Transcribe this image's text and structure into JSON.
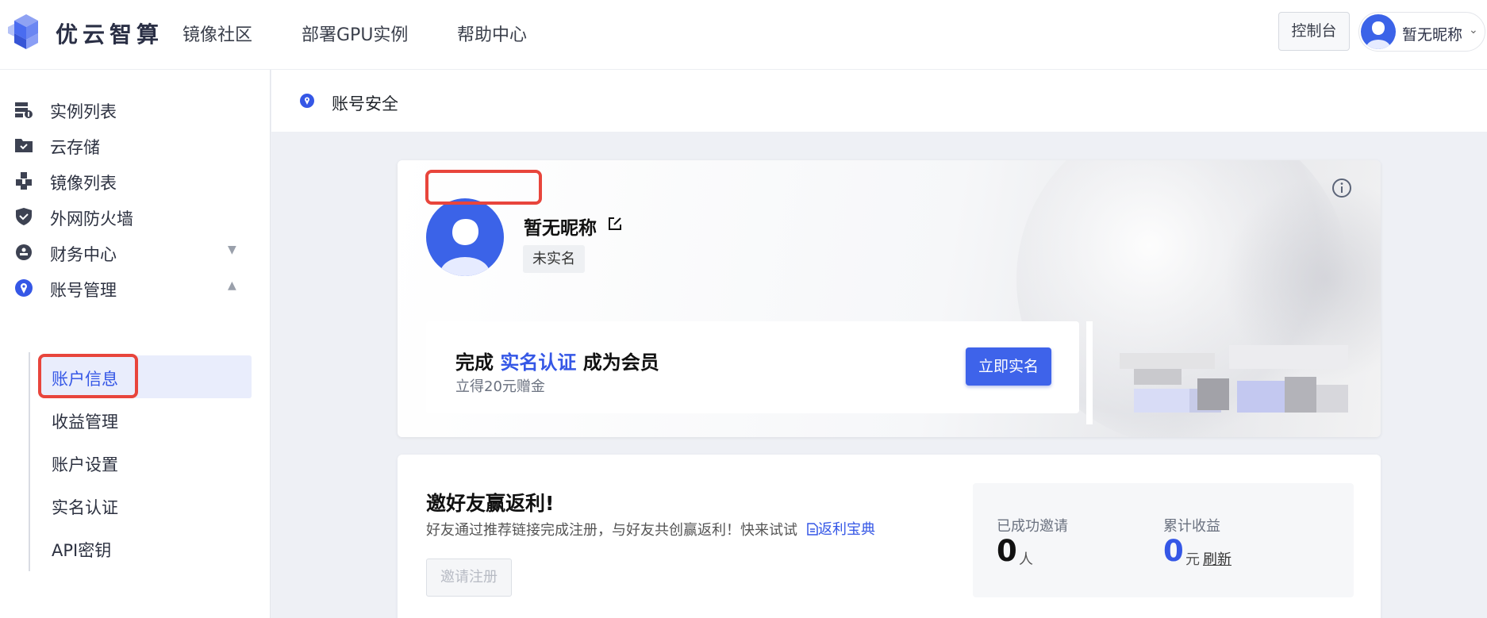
{
  "brand": "优云智算",
  "nav": {
    "items": [
      "镜像社区",
      "部署GPU实例",
      "帮助中心"
    ],
    "console": "控制台",
    "user_name": "暂无昵称",
    "chevron": "⌄"
  },
  "sidebar": {
    "items": [
      {
        "label": "实例列表",
        "icon": "server-list-icon"
      },
      {
        "label": "云存储",
        "icon": "folder-icon"
      },
      {
        "label": "镜像列表",
        "icon": "cubes-icon"
      },
      {
        "label": "外网防火墙",
        "icon": "shield-icon"
      },
      {
        "label": "财务中心",
        "icon": "finance-icon"
      },
      {
        "label": "账号管理",
        "icon": "location-pin-icon"
      }
    ],
    "finance_arrow": "▼",
    "account_arrow": "▲",
    "sub_items": [
      "账户信息",
      "收益管理",
      "账户设置",
      "实名认证",
      "API密钥"
    ]
  },
  "page": {
    "title": "账号安全"
  },
  "profile": {
    "nickname": "暂无昵称",
    "badge": "未实名",
    "promo_prefix": "完成 ",
    "promo_highlight": "实名认证",
    "promo_suffix": " 成为会员",
    "promo_sub": "立得20元赠金",
    "promo_button": "立即实名"
  },
  "invite": {
    "title": "邀好友赢返利!",
    "desc": "好友通过推荐链接完成注册，与好友共创赢返利！快来试试",
    "link": "返利宝典",
    "button": "邀请注册",
    "invited_label": "已成功邀请",
    "invited_value": "0",
    "invited_unit": "人",
    "earnings_label": "累计收益",
    "earnings_value": "0",
    "earnings_unit": "元",
    "refresh": "刷新"
  },
  "colors": {
    "accent": "#3557e6",
    "button": "#3e63ea",
    "highlight_box": "#e8453c"
  }
}
